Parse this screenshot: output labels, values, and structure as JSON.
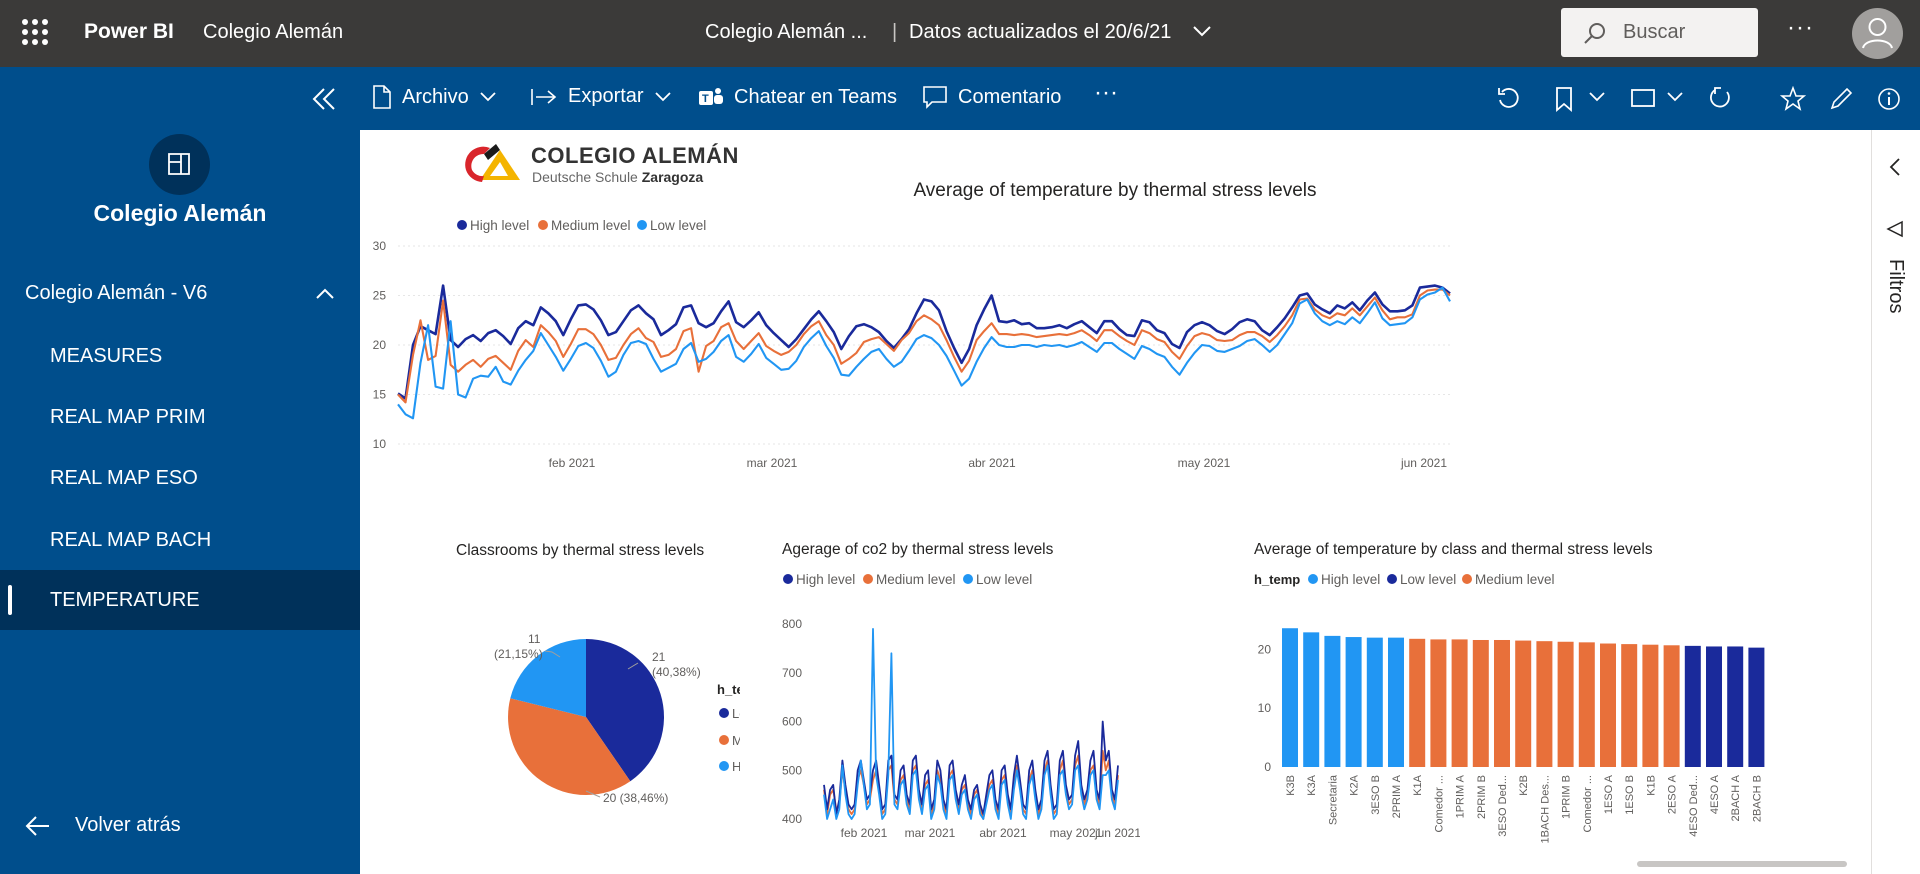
{
  "topbar": {
    "app_name": "Power BI",
    "workspace": "Colegio Alemán",
    "report_title": "Colegio Alemán ...",
    "separator": "|",
    "updated": "Datos actualizados el 20/6/21",
    "search_placeholder": "Buscar",
    "more": "···"
  },
  "actions": {
    "archivo": "Archivo",
    "exportar": "Exportar",
    "teams": "Chatear en Teams",
    "comentario": "Comentario",
    "more": "···"
  },
  "nav": {
    "workspace_title": "Colegio Alemán",
    "app_section": "Colegio Alemán - V6",
    "items": [
      "MEASURES",
      "REAL MAP PRIM",
      "REAL MAP ESO",
      "REAL MAP BACH",
      "TEMPERATURE"
    ],
    "active_index": 4,
    "back": "Volver atrás"
  },
  "right_pane": {
    "filters": "Filtros"
  },
  "logo": {
    "name": "COLEGIO ALEMÁN",
    "sub_prefix": "Deutsche Schule",
    "sub_city": "Zaragoza"
  },
  "colors": {
    "high": "#1a2a9b",
    "medium": "#e8703a",
    "low": "#2196f3",
    "topbar": "#3b3a39",
    "nav": "#004e8c",
    "nav_active": "#00315a"
  },
  "chart_data": [
    {
      "type": "line",
      "title": "Average of temperature by thermal stress levels",
      "legend": [
        "High level",
        "Medium level",
        "Low level"
      ],
      "x_tick_labels": [
        "feb 2021",
        "mar 2021",
        "abr 2021",
        "may 2021",
        "jun 2021"
      ],
      "ylim": [
        10,
        30
      ],
      "y_ticks": [
        10,
        15,
        20,
        25,
        30
      ],
      "grid": true,
      "legend_position": "top-left",
      "series": [
        {
          "name": "High level",
          "values": [
            15.1,
            14.6,
            20.0,
            21.9,
            21.5,
            21.1,
            26.0,
            20.5,
            19.8,
            20.6,
            21.0,
            20.4,
            21.2,
            21.5,
            20.9,
            20.1,
            21.7,
            22.4,
            22.0,
            23.8,
            23.2,
            22.4,
            21.0,
            22.6,
            24.0,
            24.1,
            23.6,
            22.5,
            21.0,
            21.3,
            22.4,
            23.5,
            24.0,
            23.2,
            22.6,
            21.0,
            21.5,
            22.1,
            23.8,
            24.0,
            22.2,
            21.8,
            22.2,
            23.4,
            24.4,
            22.3,
            21.8,
            22.5,
            23.3,
            22.0,
            21.2,
            20.5,
            19.8,
            20.6,
            21.6,
            22.6,
            23.4,
            22.4,
            21.3,
            19.6,
            20.9,
            21.9,
            22.1,
            21.8,
            21.3,
            20.4,
            19.7,
            20.6,
            21.6,
            23.2,
            24.6,
            24.4,
            23.5,
            21.4,
            19.7,
            18.2,
            19.6,
            22.0,
            23.6,
            25.0,
            22.4,
            22.3,
            22.5,
            22.1,
            22.2,
            21.7,
            21.7,
            21.8,
            22.0,
            21.7,
            22.1,
            22.4,
            21.8,
            21.2,
            22.4,
            22.4,
            21.6,
            21.0,
            20.9,
            22.5,
            22.3,
            21.5,
            21.2,
            20.1,
            19.7,
            21.3,
            22.0,
            22.3,
            22.0,
            21.4,
            21.1,
            21.6,
            22.3,
            22.6,
            22.4,
            21.5,
            21.0,
            21.8,
            22.7,
            23.8,
            25.0,
            25.2,
            24.1,
            23.6,
            23.2,
            24.0,
            23.7,
            24.3,
            23.5,
            24.5,
            25.3,
            24.1,
            23.4,
            23.4,
            23.5,
            24.0,
            25.8,
            25.9,
            26.0,
            25.8,
            25.2
          ]
        },
        {
          "name": "Medium level",
          "values": [
            15.0,
            14.2,
            19.0,
            22.5,
            18.5,
            18.9,
            24.5,
            18.0,
            17.3,
            18.0,
            18.5,
            17.8,
            18.6,
            18.9,
            18.2,
            17.5,
            19.4,
            20.5,
            19.8,
            22.0,
            21.3,
            20.4,
            18.8,
            20.1,
            21.6,
            21.6,
            21.1,
            20.0,
            18.5,
            18.7,
            20.0,
            21.1,
            21.7,
            20.7,
            20.3,
            18.8,
            19.0,
            19.6,
            21.4,
            21.7,
            17.3,
            19.9,
            20.4,
            21.8,
            22.2,
            20.4,
            19.6,
            20.4,
            21.2,
            19.9,
            19.4,
            19.0,
            19.3,
            20.0,
            21.1,
            21.9,
            22.4,
            21.0,
            20.0,
            18.1,
            18.6,
            19.2,
            20.3,
            20.6,
            20.8,
            20.1,
            19.4,
            20.5,
            21.2,
            22.4,
            23.0,
            22.6,
            22.0,
            20.5,
            18.8,
            17.3,
            18.4,
            20.5,
            21.4,
            22.2,
            21.1,
            21.1,
            21.0,
            21.1,
            21.0,
            20.8,
            20.9,
            21.0,
            21.1,
            21.0,
            21.2,
            21.5,
            21.0,
            20.4,
            21.5,
            21.5,
            20.9,
            20.4,
            20.0,
            21.5,
            21.2,
            20.6,
            20.3,
            19.3,
            18.6,
            19.9,
            20.9,
            21.2,
            21.0,
            20.5,
            20.4,
            20.5,
            21.0,
            21.3,
            21.3,
            20.9,
            20.3,
            21.0,
            21.9,
            23.0,
            24.6,
            24.7,
            23.6,
            23.0,
            22.7,
            23.2,
            23.0,
            23.7,
            23.0,
            23.9,
            24.8,
            23.5,
            22.6,
            22.8,
            22.8,
            23.1,
            25.0,
            25.5,
            25.6,
            25.6,
            25.0
          ]
        },
        {
          "name": "Low level",
          "values": [
            14.0,
            13.0,
            12.6,
            18.2,
            22.0,
            15.8,
            15.6,
            22.4,
            15.0,
            14.7,
            16.6,
            16.9,
            16.8,
            17.8,
            16.3,
            16.0,
            17.4,
            18.5,
            19.4,
            21.2,
            20.0,
            18.8,
            17.4,
            18.6,
            19.9,
            20.2,
            19.7,
            18.4,
            16.8,
            17.3,
            19.0,
            20.2,
            20.4,
            20.1,
            18.6,
            17.3,
            17.7,
            18.1,
            19.6,
            20.2,
            18.3,
            18.6,
            19.3,
            20.4,
            21.0,
            18.8,
            18.3,
            19.1,
            20.1,
            18.7,
            18.1,
            17.5,
            17.6,
            18.4,
            19.8,
            20.7,
            21.4,
            19.9,
            18.7,
            17.0,
            16.9,
            17.8,
            18.6,
            19.3,
            19.6,
            18.6,
            17.8,
            18.3,
            19.4,
            20.6,
            21.0,
            20.7,
            20.0,
            18.9,
            17.4,
            15.9,
            16.6,
            18.3,
            19.7,
            20.8,
            20.0,
            19.8,
            19.8,
            20.0,
            20.0,
            19.8,
            20.0,
            19.9,
            20.0,
            19.8,
            20.0,
            20.3,
            19.8,
            19.3,
            20.2,
            20.2,
            19.6,
            19.1,
            18.6,
            19.9,
            19.6,
            19.1,
            18.8,
            17.8,
            17.0,
            18.2,
            19.2,
            20.0,
            19.9,
            19.4,
            19.3,
            19.6,
            19.9,
            20.4,
            20.6,
            20.0,
            19.3,
            20.0,
            21.1,
            22.2,
            24.2,
            24.6,
            23.2,
            22.4,
            22.0,
            22.4,
            22.1,
            22.8,
            22.2,
            23.2,
            24.3,
            22.7,
            22.0,
            22.1,
            22.2,
            22.8,
            24.6,
            25.1,
            25.3,
            25.8,
            24.4
          ]
        }
      ]
    },
    {
      "type": "pie",
      "title": "Classrooms by thermal stress levels",
      "legend_title": "h_temp",
      "legend": [
        "Low level",
        "Medium level",
        "High level"
      ],
      "series": [
        {
          "name": "Low level",
          "value": 21,
          "label": "21\n(40,38%)"
        },
        {
          "name": "Medium level",
          "value": 20,
          "label": "20 (38,46%)"
        },
        {
          "name": "High level",
          "value": 11,
          "label": "11\n(21,15%)"
        }
      ],
      "slice_labels": {
        "low_value": "21",
        "low_pct": "(40,38%)",
        "medium": "20 (38,46%)",
        "high_value": "11",
        "high_pct": "(21,15%)"
      }
    },
    {
      "type": "line",
      "title": "Agerage of co2 by thermal stress levels",
      "legend": [
        "High level",
        "Medium level",
        "Low level"
      ],
      "x_tick_labels": [
        "feb 2021",
        "mar 2021",
        "abr 2021",
        "may 2021",
        "jun 2021"
      ],
      "ylim": [
        400,
        800
      ],
      "y_ticks": [
        400,
        500,
        600,
        700,
        800
      ],
      "series": [
        {
          "name": "High level",
          "values": [
            470,
            420,
            460,
            470,
            410,
            440,
            520,
            470,
            430,
            420,
            430,
            500,
            520,
            480,
            440,
            450,
            500,
            520,
            470,
            420,
            430,
            520,
            530,
            450,
            440,
            500,
            510,
            450,
            430,
            520,
            530,
            460,
            430,
            490,
            500,
            420,
            440,
            520,
            500,
            440,
            420,
            510,
            520,
            460,
            430,
            470,
            490,
            440,
            420,
            460,
            470,
            430,
            410,
            450,
            490,
            500,
            440,
            420,
            500,
            510,
            450,
            420,
            490,
            530,
            480,
            430,
            420,
            500,
            520,
            460,
            420,
            440,
            520,
            540,
            470,
            420,
            430,
            520,
            540,
            470,
            440,
            450,
            530,
            560,
            470,
            440,
            460,
            520,
            540,
            460,
            440,
            600,
            520,
            540,
            460,
            440,
            510
          ]
        },
        {
          "name": "Medium level",
          "values": [
            460,
            410,
            450,
            460,
            420,
            430,
            500,
            460,
            420,
            410,
            420,
            480,
            500,
            470,
            430,
            440,
            480,
            500,
            460,
            410,
            420,
            500,
            510,
            440,
            430,
            480,
            490,
            440,
            420,
            500,
            510,
            450,
            420,
            470,
            480,
            410,
            430,
            500,
            480,
            430,
            410,
            490,
            500,
            450,
            420,
            460,
            470,
            430,
            410,
            450,
            460,
            420,
            400,
            440,
            470,
            480,
            430,
            410,
            480,
            490,
            440,
            410,
            470,
            510,
            470,
            420,
            410,
            480,
            500,
            450,
            410,
            430,
            500,
            520,
            460,
            410,
            420,
            500,
            520,
            460,
            430,
            440,
            510,
            530,
            460,
            430,
            450,
            500,
            510,
            450,
            430,
            540,
            500,
            520,
            450,
            430,
            490
          ]
        },
        {
          "name": "Low level",
          "values": [
            450,
            400,
            420,
            440,
            400,
            420,
            510,
            450,
            410,
            400,
            410,
            470,
            520,
            470,
            420,
            430,
            790,
            490,
            450,
            400,
            410,
            490,
            740,
            430,
            420,
            470,
            480,
            430,
            410,
            490,
            500,
            440,
            410,
            460,
            470,
            400,
            420,
            490,
            470,
            420,
            400,
            480,
            490,
            440,
            410,
            450,
            460,
            420,
            400,
            440,
            450,
            410,
            400,
            430,
            460,
            470,
            420,
            400,
            470,
            480,
            430,
            400,
            460,
            500,
            460,
            410,
            400,
            470,
            490,
            440,
            400,
            420,
            490,
            510,
            450,
            400,
            410,
            490,
            500,
            450,
            420,
            430,
            500,
            510,
            450,
            420,
            440,
            490,
            500,
            440,
            420,
            490,
            490,
            500,
            440,
            420,
            480
          ]
        }
      ]
    },
    {
      "type": "bar",
      "title": "Average of temperature by class and thermal stress levels",
      "legend_title": "h_temp",
      "legend": [
        "High level",
        "Low level",
        "Medium level"
      ],
      "categories": [
        "K3B",
        "K3A",
        "Secretaria",
        "K2A",
        "3ESO B",
        "2PRIM A",
        "K1A",
        "Comedor ...",
        "1PRIM A",
        "2PRIM B",
        "3ESO Ded...",
        "K2B",
        "1BACH Des...",
        "1PRIM B",
        "Comedor ...",
        "1ESO A",
        "1ESO B",
        "K1B",
        "2ESO A",
        "4ESO Ded...",
        "4ESO A",
        "2BACH A",
        "2BACH B"
      ],
      "values": [
        23.6,
        22.9,
        22.3,
        22.1,
        22.0,
        22.0,
        21.8,
        21.7,
        21.7,
        21.6,
        21.6,
        21.5,
        21.4,
        21.3,
        21.2,
        21.0,
        20.9,
        20.8,
        20.7,
        20.6,
        20.5,
        20.5,
        20.3
      ],
      "levels": [
        "High level",
        "High level",
        "High level",
        "High level",
        "High level",
        "High level",
        "Medium level",
        "Medium level",
        "Medium level",
        "Medium level",
        "Medium level",
        "Medium level",
        "Medium level",
        "Medium level",
        "Medium level",
        "Medium level",
        "Medium level",
        "Medium level",
        "Medium level",
        "Low level",
        "Low level",
        "Low level",
        "Low level"
      ],
      "ylim": [
        0,
        25
      ],
      "y_ticks": [
        0,
        10,
        20
      ]
    }
  ]
}
